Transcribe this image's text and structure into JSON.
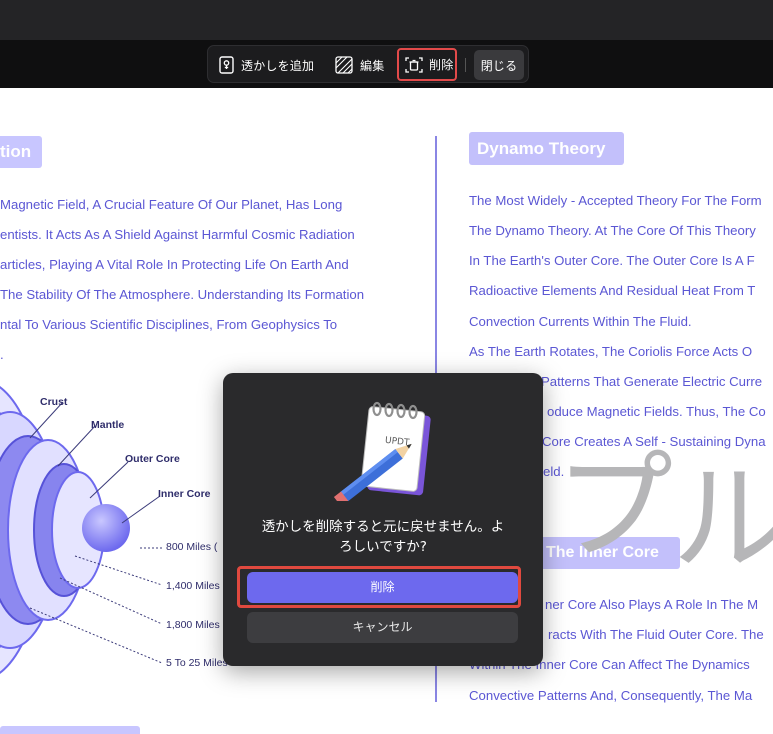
{
  "toolbar": {
    "add_watermark_label": "透かしを追加",
    "edit_label": "編集",
    "delete_label": "削除",
    "close_label": "閉じる"
  },
  "document": {
    "left_heading": "tion",
    "left_paragraph": [
      "Magnetic Field, A Crucial Feature Of Our Planet, Has Long",
      "entists. It Acts As A Shield Against Harmful Cosmic Radiation",
      "articles, Playing A Vital Role In Protecting Life On Earth And",
      "The Stability Of The Atmosphere. Understanding Its Formation",
      "ntal To Various Scientific Disciplines, From Geophysics To",
      "."
    ],
    "diagram_labels": {
      "crust": "Crust",
      "mantle": "Mantle",
      "outer_core": "Outer Core",
      "inner_core": "Inner Core",
      "distance_1": "800 Miles (",
      "distance_2": "1,400 Miles",
      "distance_3": "1,800 Miles",
      "distance_4": "5 To 25 Miles"
    },
    "right_heading": "Dynamo Theory",
    "right_paragraph": [
      "The Most Widely - Accepted Theory For The Form",
      "The Dynamo Theory. At The Core Of This Theory",
      "In The Earth's Outer Core. The Outer Core Is A F",
      "Radioactive Elements And Residual Heat From T",
      "Convection Currents Within The Fluid.",
      "As The Earth Rotates, The Coriolis Force Acts O",
      "Patterns That Generate Electric Curre",
      "oduce Magnetic Fields. Thus, The Co",
      "Core Creates A Self - Sustaining Dyna",
      "eld."
    ],
    "right_subheading": "The Inner Core",
    "right_paragraph_2": [
      "ner Core Also Plays A Role In The M",
      "racts With The Fluid Outer Core. The",
      "Within The Inner Core Can Affect The Dynamics",
      "Convective Patterns And, Consequently, The Ma"
    ],
    "watermark_glyphs": [
      "プ",
      "ル"
    ]
  },
  "dialog": {
    "icon": "notepad-pencil-icon",
    "message_line1": "透かしを削除すると元に戻せません。よ",
    "message_line2": "ろしいですか?",
    "confirm_label": "削除",
    "cancel_label": "キャンセル"
  },
  "colors": {
    "accent": "#6d69ee",
    "highlight_frame": "#e34a4a",
    "doc_text": "#5b57d4",
    "heading_badge": "#c3c0fb",
    "dialog_bg": "#2a2a2c"
  }
}
